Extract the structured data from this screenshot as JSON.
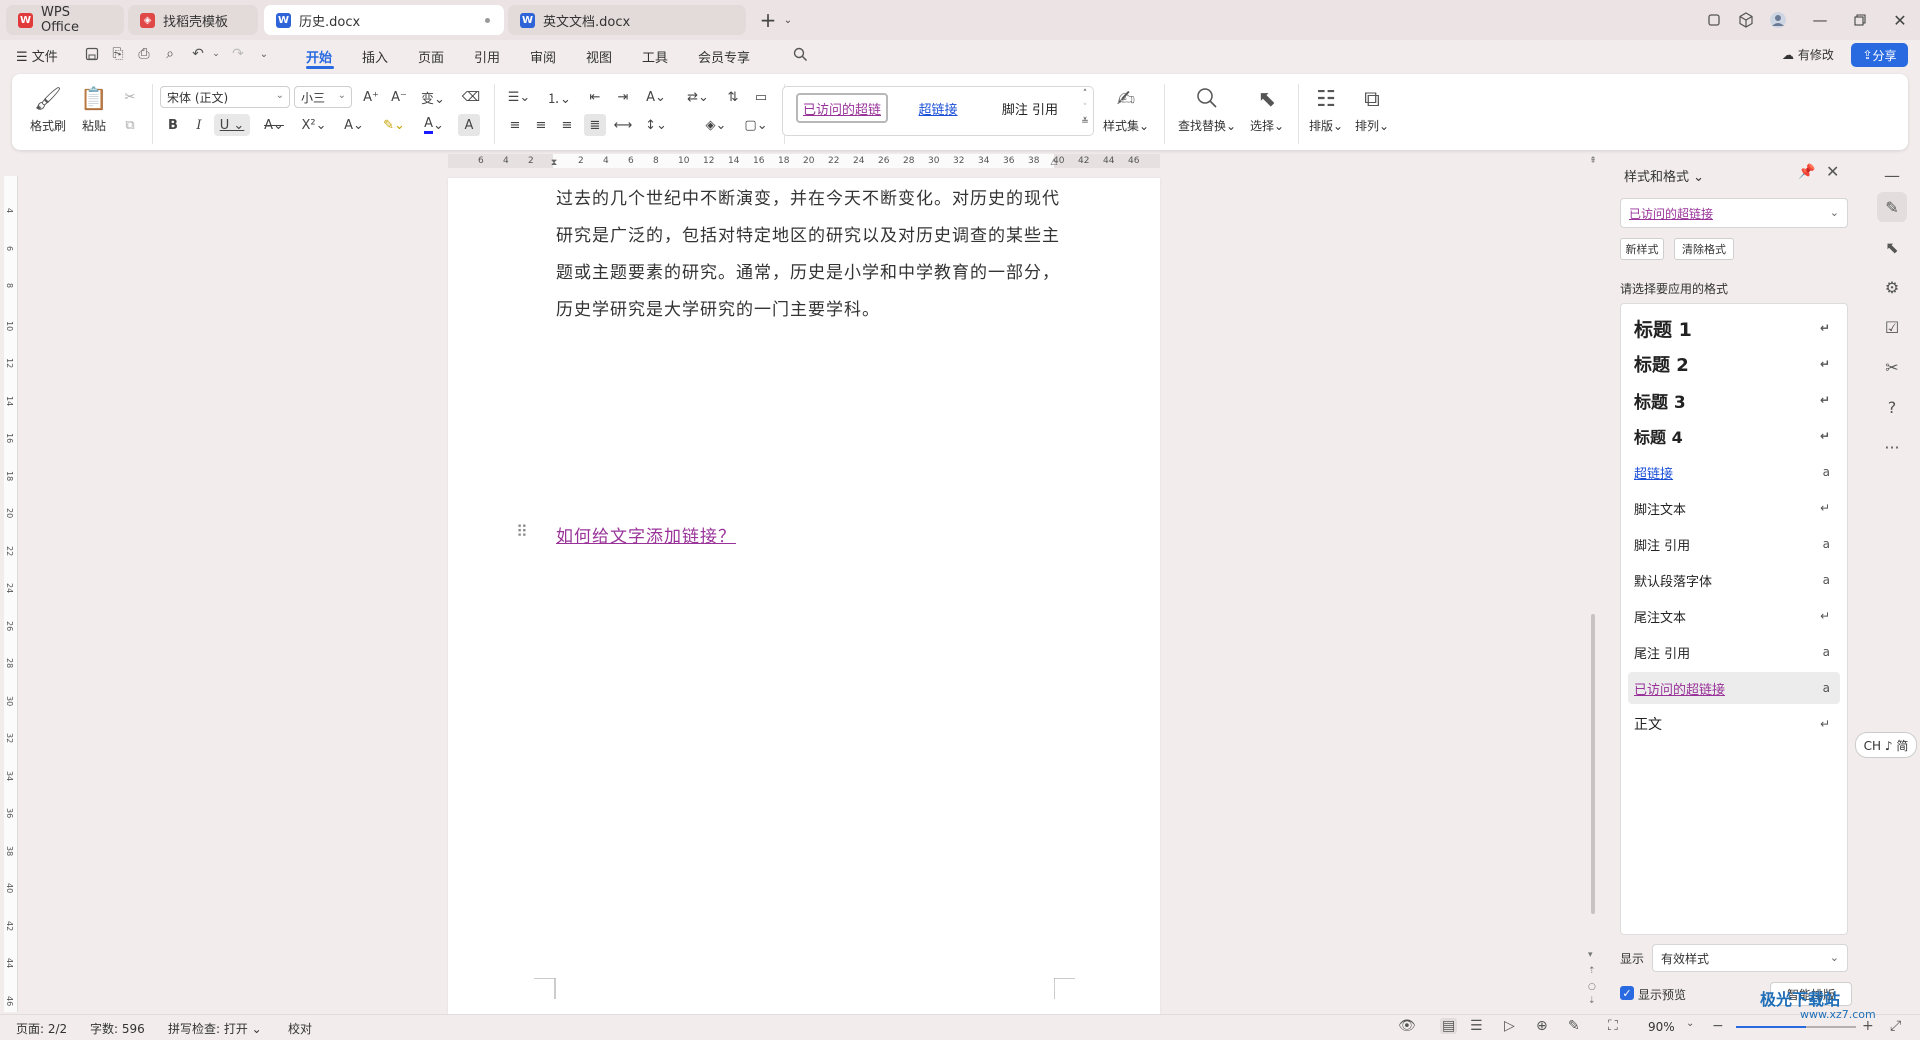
{
  "tabs": [
    {
      "label": "WPS Office",
      "icon": "wps-logo"
    },
    {
      "label": "找稻壳模板",
      "icon": "docer-icon"
    },
    {
      "label": "历史.docx",
      "icon": "word-doc-icon"
    },
    {
      "label": "英文文档.docx",
      "icon": "word-doc-icon"
    }
  ],
  "menu": {
    "file": "文件",
    "items": [
      "开始",
      "插入",
      "页面",
      "引用",
      "审阅",
      "视图",
      "工具",
      "会员专享"
    ],
    "active": "开始",
    "modified_label": "有修改",
    "share_label": "分享"
  },
  "ribbon": {
    "format_painter": "格式刷",
    "paste": "粘贴",
    "font_name": "宋体 (正文)",
    "font_size": "小三",
    "gallery": [
      "已访问的超链",
      "超链接",
      "脚注 引用"
    ],
    "styles_set": "样式集",
    "find_replace": "查找替换",
    "select": "选择",
    "layout": "排版",
    "arrange": "排列"
  },
  "ruler": {
    "h_ticks": [
      "6",
      "4",
      "2",
      "2",
      "4",
      "6",
      "8",
      "10",
      "12",
      "14",
      "16",
      "18",
      "20",
      "22",
      "24",
      "26",
      "28",
      "30",
      "32",
      "34",
      "36",
      "38",
      "40",
      "42",
      "44",
      "46"
    ],
    "v_ticks": [
      "4",
      "6",
      "8",
      "10",
      "12",
      "14",
      "16",
      "18",
      "20",
      "22",
      "24",
      "26",
      "28",
      "30",
      "32",
      "34",
      "36",
      "38",
      "40",
      "42",
      "44",
      "46"
    ]
  },
  "document": {
    "lines": [
      "过去的几个世纪中不断演变，并在今天不断变化。对历史的现代",
      "研究是广泛的，包括对特定地区的研究以及对历史调查的某些主",
      "题或主题要素的研究。通常，历史是小学和中学教育的一部分，",
      "历史学研究是大学研究的一门主要学科。"
    ],
    "link_text": "如何给文字添加链接？"
  },
  "styles_pane": {
    "title": "样式和格式",
    "current_style": "已访问的超链接",
    "new_style": "新样式",
    "clear_format": "清除格式",
    "choose_label": "请选择要应用的格式",
    "items": [
      {
        "label": "标题  1",
        "mark": "↵"
      },
      {
        "label": "标题  2",
        "mark": "↵"
      },
      {
        "label": "标题  3",
        "mark": "↵"
      },
      {
        "label": "标题  4",
        "mark": "↵"
      },
      {
        "label": "超链接",
        "mark": "a"
      },
      {
        "label": "脚注文本",
        "mark": "↵"
      },
      {
        "label": "脚注 引用",
        "mark": "a"
      },
      {
        "label": "默认段落字体",
        "mark": "a"
      },
      {
        "label": "尾注文本",
        "mark": "↵"
      },
      {
        "label": "尾注 引用",
        "mark": "a"
      },
      {
        "label": "已访问的超链接",
        "mark": "a"
      },
      {
        "label": "正文",
        "mark": "↵"
      }
    ],
    "selected_index": 10,
    "show_label": "显示",
    "show_value": "有效样式",
    "preview_label": "显示预览",
    "smart_layout": "智能排版"
  },
  "ime": "CH ♪ 简",
  "status": {
    "page": "页面: 2/2",
    "words": "字数: 596",
    "spell": "拼写检查: 打开",
    "proof": "校对",
    "zoom": "90%"
  },
  "watermark": {
    "title": "极光下载站",
    "sub": "www.xz7.com"
  },
  "colors": {
    "accent": "#2a6ae0",
    "visited_link": "#993399",
    "link": "#1a4fd6"
  }
}
